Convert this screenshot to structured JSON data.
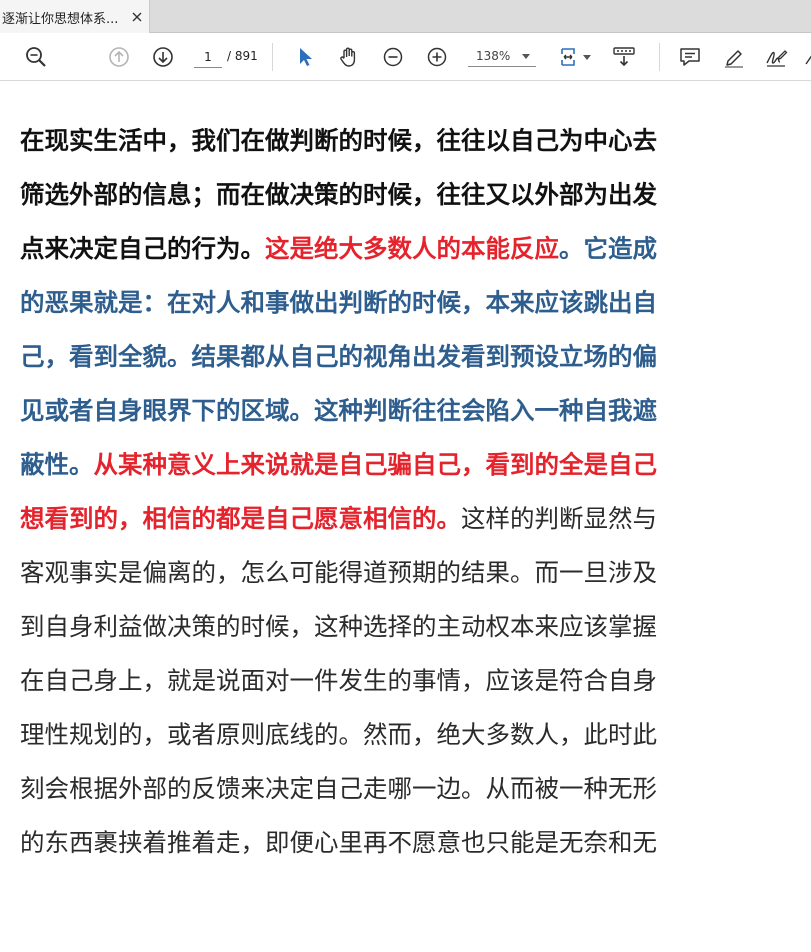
{
  "window": {
    "tab_title": "逐渐让你思想体系..."
  },
  "toolbar": {
    "current_page": "1",
    "page_total": "/ 891",
    "zoom": "138%",
    "icons": [
      "zoom-out-magnifier-icon",
      "prev-page-icon",
      "next-page-icon",
      "select-cursor-icon",
      "hand-tool-icon",
      "zoom-minus-icon",
      "zoom-plus-icon",
      "fit-page-icon",
      "scroll-mode-icon",
      "comment-icon",
      "highlight-pen-icon",
      "sign-icon"
    ],
    "accent_color": "#2c6fbb"
  },
  "document": {
    "colors": {
      "red": "#e5232c",
      "blue": "#2e5e8e",
      "black": "#111111"
    },
    "lines": [
      [
        {
          "style": "black-bold",
          "text": "在现实生活中，我们在做判断的时候，往往以自己为中心去"
        }
      ],
      [
        {
          "style": "black-bold",
          "text": "筛选外部的信息；而在做决策的时候，往往又以外部为出发"
        }
      ],
      [
        {
          "style": "black-bold",
          "text": "点来决定自己的行为。"
        },
        {
          "style": "red-bold",
          "text": "这是绝大多数人的本能反应"
        },
        {
          "style": "blue-bold",
          "text": "。它造成"
        }
      ],
      [
        {
          "style": "blue-bold",
          "text": "的恶果就是：在对人和事做出判断的时候，本来应该跳出自"
        }
      ],
      [
        {
          "style": "blue-bold",
          "text": "己，看到全貌。结果都从自己的视角出发看到预设立场的偏"
        }
      ],
      [
        {
          "style": "blue-bold",
          "text": "见或者自身眼界下的区域。这种判断往往会陷入一种自我遮"
        }
      ],
      [
        {
          "style": "blue-bold",
          "text": "蔽性。"
        },
        {
          "style": "red-bold",
          "text": "从某种意义上来说就是自己骗自己，看到的全是自己"
        }
      ],
      [
        {
          "style": "red-bold",
          "text": "想看到的，相信的都是自己愿意相信的。"
        },
        {
          "style": "normal",
          "text": "这样的判断显然与"
        }
      ],
      [
        {
          "style": "normal",
          "text": "客观事实是偏离的，怎么可能得道预期的结果。而一旦涉及"
        }
      ],
      [
        {
          "style": "normal",
          "text": "到自身利益做决策的时候，这种选择的主动权本来应该掌握"
        }
      ],
      [
        {
          "style": "normal",
          "text": "在自己身上，就是说面对一件发生的事情，应该是符合自身"
        }
      ],
      [
        {
          "style": "normal",
          "text": "理性规划的，或者原则底线的。然而，绝大多数人，此时此"
        }
      ],
      [
        {
          "style": "normal",
          "text": "刻会根据外部的反馈来决定自己走哪一边。从而被一种无形"
        }
      ],
      [
        {
          "style": "normal",
          "text": "的东西裹挟着推着走，即便心里再不愿意也只能是无奈和无"
        }
      ]
    ]
  }
}
